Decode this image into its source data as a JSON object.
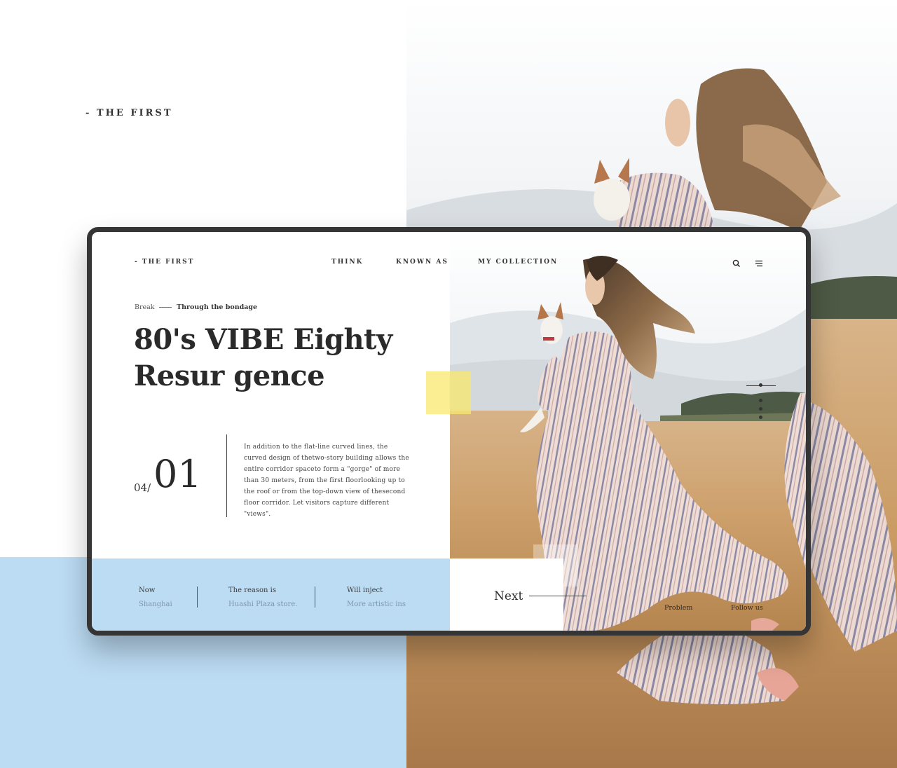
{
  "brand": "- THE FIRST",
  "nav": {
    "items": [
      "THINK",
      "KNOWN AS",
      "MY COLLECTION"
    ],
    "search_icon": "search-icon",
    "menu_icon": "hamburger-menu-icon"
  },
  "breadcrumb": {
    "first": "Break",
    "second": "Through the bondage"
  },
  "hero": {
    "title_line1": "80's VIBE Eighty",
    "title_line2": "Resur gence"
  },
  "pager": {
    "total": "04/",
    "current": "01"
  },
  "description": "In addition to the flat-line curved lines, the curved design of thetwo-story building allows the entire corridor spaceto form a \"gorge\" of more than 30 meters, from the first floorlooking up to the roof or from the top-down view of thesecond floor corridor. Let visitors capture different \"views\".",
  "info": [
    {
      "label": "Now",
      "value": "Shanghai"
    },
    {
      "label": "The reason is",
      "value": "Huashi Plaza store."
    },
    {
      "label": "Will inject",
      "value": "More artistic ins"
    }
  ],
  "next_label": "Next",
  "footer_links": [
    "Problem",
    "Follow us"
  ],
  "colors": {
    "accent_blue": "#bcdcf4",
    "accent_yellow": "#fae86e",
    "frame": "#353535",
    "text": "#2a2a2a"
  }
}
